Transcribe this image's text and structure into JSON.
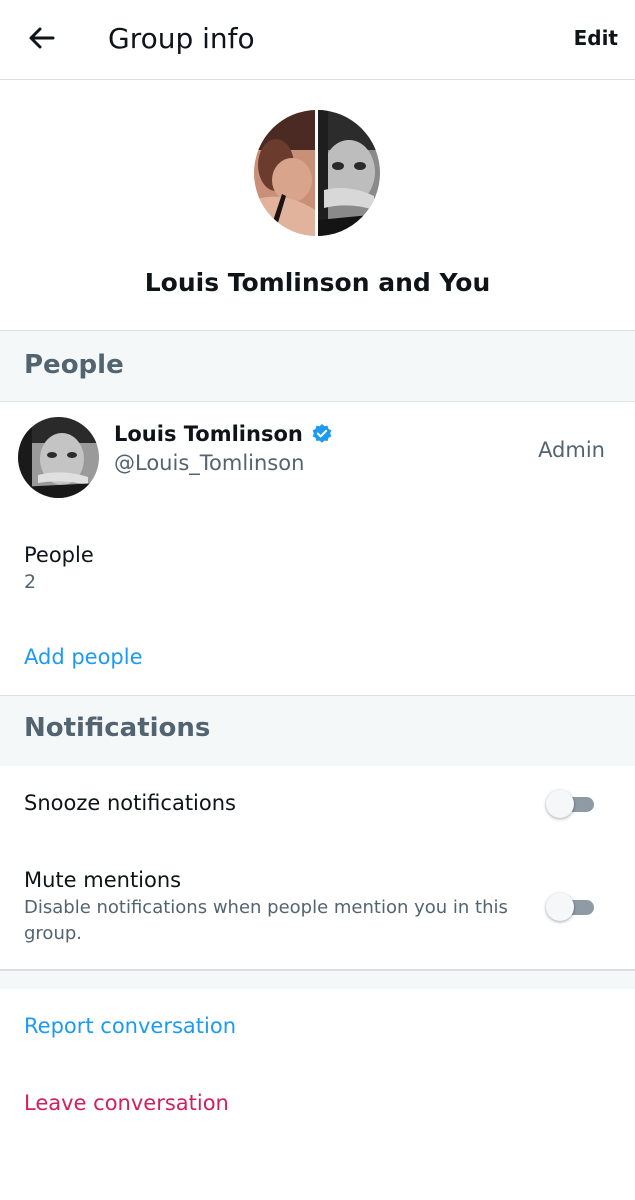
{
  "header": {
    "title": "Group info",
    "edit_label": "Edit",
    "back_icon": "arrow-left-icon"
  },
  "group": {
    "name": "Louis Tomlinson and You"
  },
  "people_section": {
    "heading": "People",
    "members": [
      {
        "name": "Louis Tomlinson",
        "handle": "@Louis_Tomlinson",
        "role": "Admin",
        "verified": true
      }
    ],
    "count_label": "People",
    "count_value": "2",
    "add_label": "Add people"
  },
  "notifications_section": {
    "heading": "Notifications",
    "snooze": {
      "label": "Snooze notifications",
      "enabled": false
    },
    "mute": {
      "label": "Mute mentions",
      "description": "Disable notifications when people mention you in this group.",
      "enabled": false
    }
  },
  "actions": {
    "report_label": "Report conversation",
    "leave_label": "Leave conversation"
  },
  "colors": {
    "accent": "#1d9bf0",
    "danger": "#d21f5f",
    "section_bg": "#f5f8f8",
    "secondary_text": "#536471"
  }
}
